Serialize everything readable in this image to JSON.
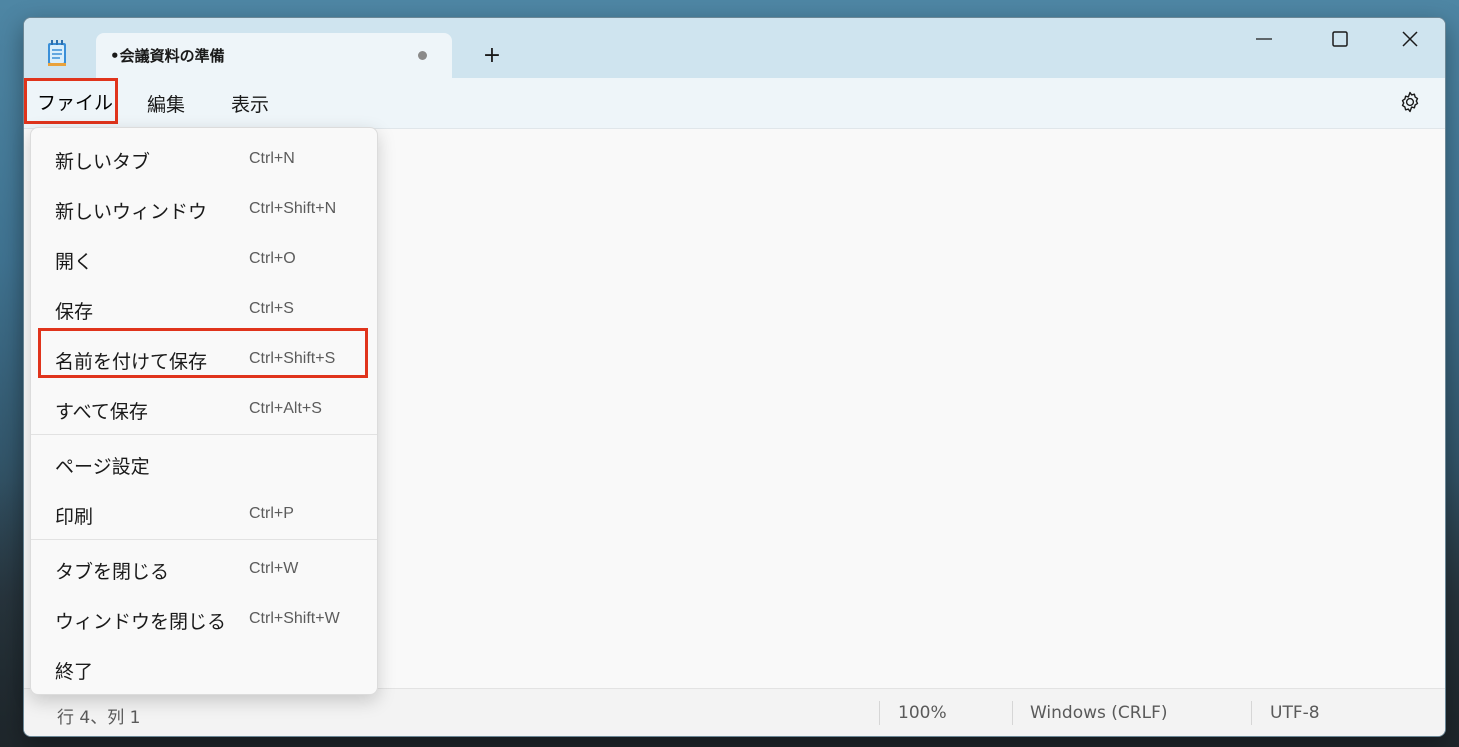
{
  "window": {
    "tab_title": "•会議資料の準備",
    "new_tab_label": "+"
  },
  "menubar": {
    "file": "ファイル",
    "edit": "編集",
    "view": "表示"
  },
  "file_menu": {
    "items": [
      {
        "label": "新しいタブ",
        "shortcut": "Ctrl+N"
      },
      {
        "label": "新しいウィンドウ",
        "shortcut": "Ctrl+Shift+N"
      },
      {
        "label": "開く",
        "shortcut": "Ctrl+O"
      },
      {
        "label": "保存",
        "shortcut": "Ctrl+S"
      },
      {
        "label": "名前を付けて保存",
        "shortcut": "Ctrl+Shift+S"
      },
      {
        "label": "すべて保存",
        "shortcut": "Ctrl+Alt+S"
      },
      {
        "label": "ページ設定",
        "shortcut": ""
      },
      {
        "label": "印刷",
        "shortcut": "Ctrl+P"
      },
      {
        "label": "タブを閉じる",
        "shortcut": "Ctrl+W"
      },
      {
        "label": "ウィンドウを閉じる",
        "shortcut": "Ctrl+Shift+W"
      },
      {
        "label": "終了",
        "shortcut": ""
      }
    ]
  },
  "statusbar": {
    "position": "行 4、列 1",
    "zoom": "100%",
    "line_ending": "Windows (CRLF)",
    "encoding": "UTF-8"
  },
  "colors": {
    "highlight_border": "#e0341c",
    "titlebar": "#cfe4ef",
    "menubar": "#eef5f9"
  }
}
